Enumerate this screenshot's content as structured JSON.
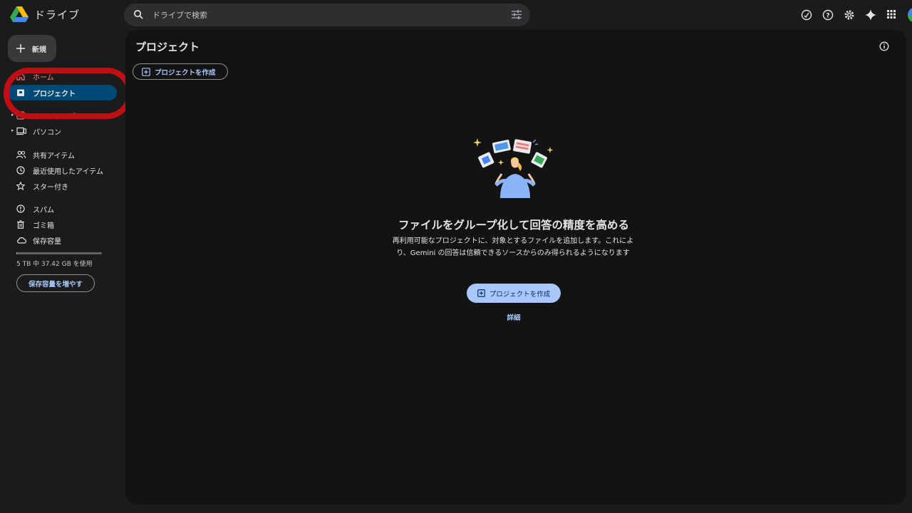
{
  "app": {
    "name": "ドライブ"
  },
  "search": {
    "placeholder": "ドライブで検索"
  },
  "header_icons": [
    "offline-status-icon",
    "help-icon",
    "settings-icon",
    "gemini-sparkle-icon",
    "apps-grid-icon"
  ],
  "sidebar": {
    "new_label": "新規",
    "items": [
      {
        "label": "ホーム",
        "icon": "home-icon"
      },
      {
        "label": "プロジェクト",
        "icon": "project-icon",
        "active": true
      },
      {
        "label": "マイドライブ",
        "icon": "my-drive-icon"
      },
      {
        "label": "パソコン",
        "icon": "computer-icon"
      },
      {
        "label": "共有アイテム",
        "icon": "shared-icon"
      },
      {
        "label": "最近使用したアイテム",
        "icon": "clock-icon"
      },
      {
        "label": "スター付き",
        "icon": "star-icon"
      },
      {
        "label": "スパム",
        "icon": "spam-icon"
      },
      {
        "label": "ゴミ箱",
        "icon": "trash-icon"
      },
      {
        "label": "保存容量",
        "icon": "cloud-icon"
      }
    ],
    "storage": {
      "used_text": "5 TB 中 37.42 GB を使用",
      "used_fraction": 0.007,
      "button_label": "保存容量を増やす"
    }
  },
  "main": {
    "title": "プロジェクト",
    "create_chip_label": "プロジェクトを作成",
    "empty_state": {
      "title": "ファイルをグループ化して回答の精度を高める",
      "description": "再利用可能なプロジェクトに、対象とするファイルを追加します。これにより、Gemini の回答は信頼できるソースからのみ得られるようになります",
      "button_label": "プロジェクトを作成",
      "link_label": "詳細"
    }
  },
  "colors": {
    "accent": "#a8c7fa",
    "active_nav": "#004a77",
    "highlight_ring": "#c00f14",
    "background": "#1b1b1b",
    "panel": "#131314"
  }
}
